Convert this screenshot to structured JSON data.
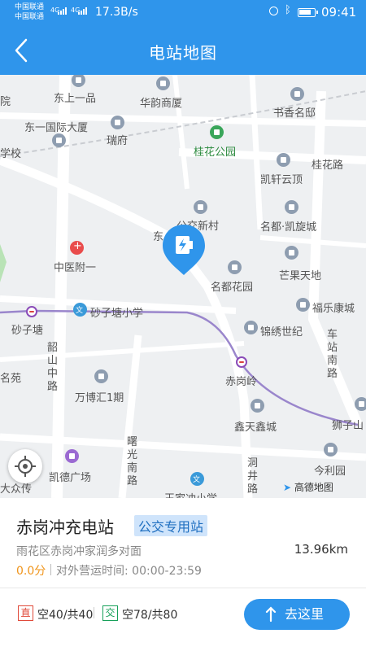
{
  "status_bar": {
    "carrier1": "中国联通",
    "carrier2": "中国联通",
    "net1": "4G",
    "net2": "4G",
    "speed": "17.3B/s",
    "time": "09:41"
  },
  "header": {
    "title": "电站地图"
  },
  "map": {
    "labels": {
      "dongshang": "东上一品",
      "huaqiao": "华韵商厦",
      "shuxiang": "书香名邸",
      "dongyi": "东一国际大厦",
      "ruifu": "瑞府",
      "xuexiao": "学校",
      "guihua_park": "桂花公园",
      "guihua_rd": "桂花路",
      "kaixuan": "凯轩云顶",
      "gongjiao": "公交新村",
      "mingdu": "名都·凯旋城",
      "zhongyi": "中医附一",
      "mangguo": "芒果天地",
      "mingdu_garden": "名都花园",
      "shazitang_school": "砂子塘小学",
      "fule": "福乐康城",
      "shazitang": "砂子塘",
      "jinxiu": "锦绣世纪",
      "shaoshan": "韶山中路",
      "chegang": "赤岗岭",
      "zhanbei": "车站南路",
      "mingyuan": "名苑",
      "wanbo": "万博汇1期",
      "xintian": "鑫天鑫城",
      "shizishan": "狮子山",
      "dongjing": "洞井路",
      "jinli": "今利园",
      "kaide": "凯德广场",
      "shuguang": "曙光南路",
      "wangjia": "王家冲小学",
      "dazhong": "大众传",
      "logo": "高德地图",
      "dong_rd": "东",
      "yuan": "院"
    }
  },
  "station": {
    "name": "赤岗冲充电站",
    "tag": "公交专用站",
    "address": "雨花区赤岗冲家润多对面",
    "distance": "13.96km",
    "score": "0.0分",
    "hours": "对外营运时间: 00:00-23:59"
  },
  "chargers": {
    "dc_badge": "直",
    "dc_count": "空40/共40",
    "ac_badge": "交",
    "ac_count": "空78/共80"
  },
  "actions": {
    "go_label": "去这里",
    "go_icon": "arrow-up-icon"
  },
  "colors": {
    "brand": "#2f95eb",
    "tag_bg": "#cfe4fb",
    "score": "#f0941a",
    "dc": "#e04a3a",
    "ac": "#18a05a"
  }
}
